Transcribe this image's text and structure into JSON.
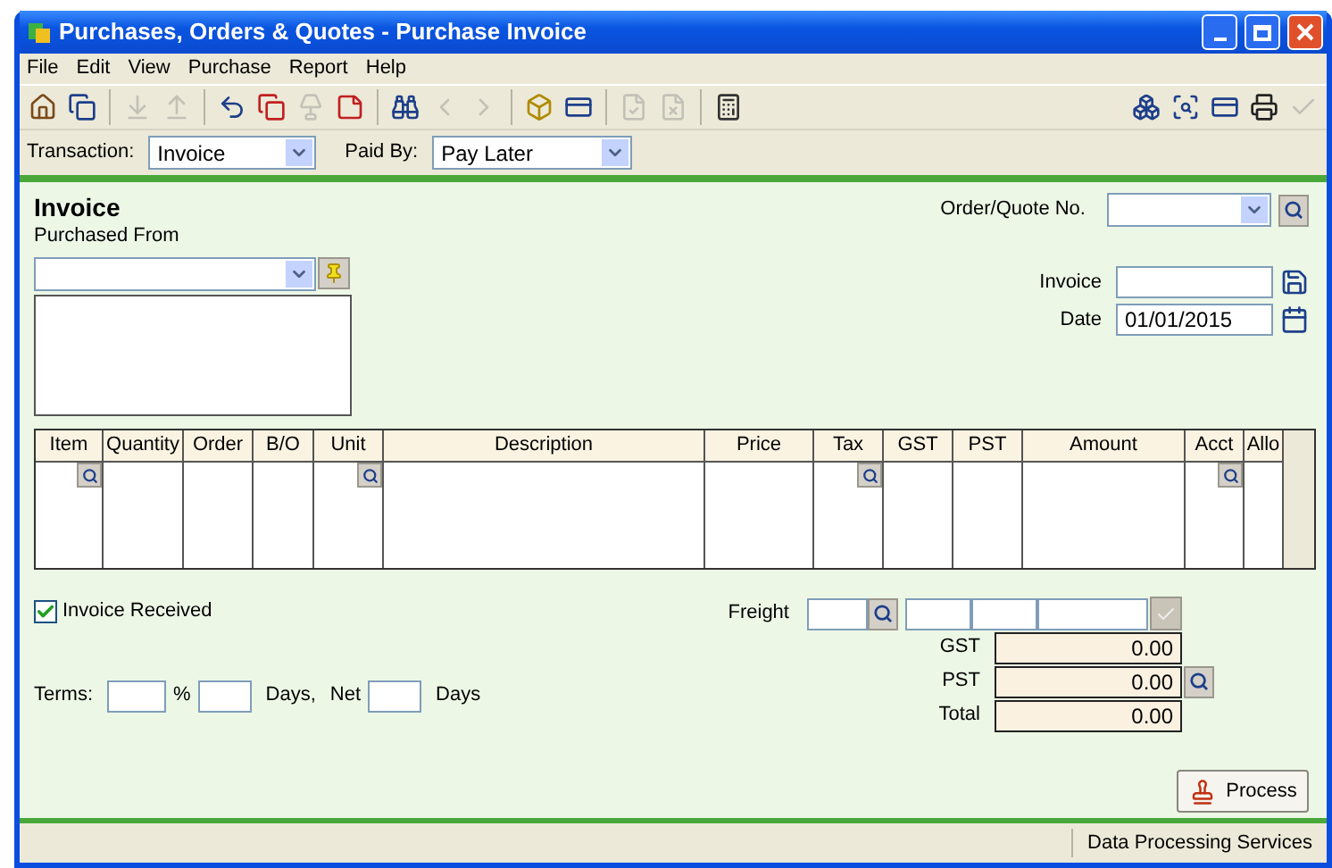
{
  "window": {
    "title": "Purchases, Orders & Quotes - Purchase Invoice"
  },
  "menu": [
    "File",
    "Edit",
    "View",
    "Purchase",
    "Report",
    "Help"
  ],
  "toolbar_left": [
    {
      "kind": "home",
      "disabled": false
    },
    {
      "kind": "windows",
      "disabled": false
    },
    {
      "kind": "sep"
    },
    {
      "kind": "tray-down",
      "disabled": true
    },
    {
      "kind": "tray-up",
      "disabled": true
    },
    {
      "kind": "sep"
    },
    {
      "kind": "undo",
      "disabled": false
    },
    {
      "kind": "copy",
      "disabled": false
    },
    {
      "kind": "lamp",
      "disabled": true
    },
    {
      "kind": "note",
      "disabled": false
    },
    {
      "kind": "sep"
    },
    {
      "kind": "binoculars",
      "disabled": false
    },
    {
      "kind": "prev",
      "disabled": true
    },
    {
      "kind": "next",
      "disabled": true
    },
    {
      "kind": "sep"
    },
    {
      "kind": "box",
      "disabled": false
    },
    {
      "kind": "card",
      "disabled": false
    },
    {
      "kind": "sep"
    },
    {
      "kind": "doc-check",
      "disabled": true
    },
    {
      "kind": "doc-x",
      "disabled": true
    },
    {
      "kind": "sep"
    },
    {
      "kind": "calculator",
      "disabled": false
    }
  ],
  "toolbar_right": [
    {
      "kind": "cube",
      "disabled": false
    },
    {
      "kind": "magnifier",
      "disabled": false
    },
    {
      "kind": "card",
      "disabled": false
    },
    {
      "kind": "printer",
      "disabled": false
    },
    {
      "kind": "check",
      "disabled": true
    }
  ],
  "transaction": {
    "label": "Transaction:",
    "value": "Invoice"
  },
  "paid_by": {
    "label": "Paid By:",
    "value": "Pay Later"
  },
  "heading": "Invoice",
  "purchased_from": {
    "label": "Purchased From"
  },
  "order_quote": {
    "label": "Order/Quote No."
  },
  "invoice": {
    "label": "Invoice"
  },
  "date": {
    "label": "Date",
    "value": "01/01/2015"
  },
  "table": {
    "columns": [
      {
        "label": "Item",
        "lookup": true
      },
      {
        "label": "Quantity",
        "lookup": false
      },
      {
        "label": "Order",
        "lookup": false
      },
      {
        "label": "B/O",
        "lookup": false
      },
      {
        "label": "Unit",
        "lookup": true
      },
      {
        "label": "Description",
        "lookup": false
      },
      {
        "label": "Price",
        "lookup": false
      },
      {
        "label": "Tax",
        "lookup": true
      },
      {
        "label": "GST",
        "lookup": false
      },
      {
        "label": "PST",
        "lookup": false
      },
      {
        "label": "Amount",
        "lookup": false
      },
      {
        "label": "Acct",
        "lookup": true
      },
      {
        "label": "Allo",
        "lookup": false
      }
    ]
  },
  "invoice_received": {
    "label": "Invoice Received",
    "checked": true
  },
  "terms": {
    "label": "Terms:",
    "percent": "%",
    "days": "Days,",
    "net": "Net",
    "days2": "Days"
  },
  "freight": {
    "label": "Freight"
  },
  "totals": [
    {
      "label": "GST",
      "value": "0.00",
      "lookup": false
    },
    {
      "label": "PST",
      "value": "0.00",
      "lookup": true
    },
    {
      "label": "Total",
      "value": "0.00",
      "lookup": false
    }
  ],
  "process_button": {
    "label": "Process"
  },
  "status_bar": {
    "text": "Data Processing Services"
  }
}
